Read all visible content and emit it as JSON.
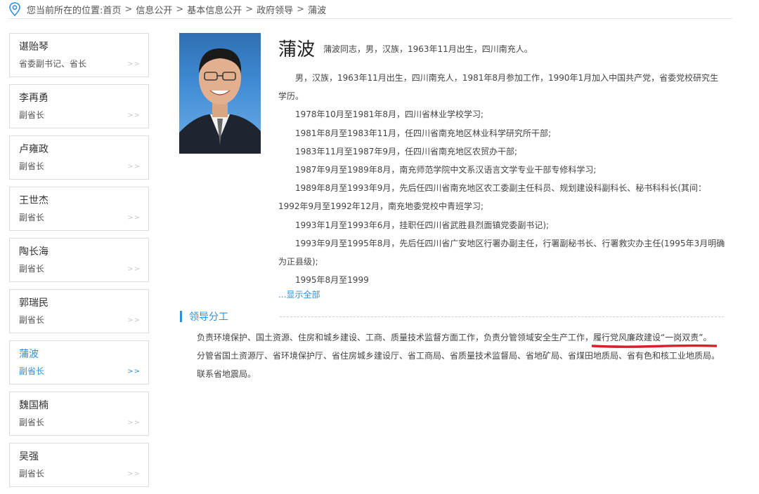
{
  "breadcrumb": {
    "prefix": "您当前所在的位置:",
    "items": [
      "首页",
      "信息公开",
      "基本信息公开",
      "政府领导",
      "蒲波"
    ],
    "separator": ">"
  },
  "sidebar": {
    "arrow": ">>",
    "items": [
      {
        "name": "谌贻琴",
        "title": "省委副书记、省长"
      },
      {
        "name": "李再勇",
        "title": "副省长"
      },
      {
        "name": "卢雍政",
        "title": "副省长"
      },
      {
        "name": "王世杰",
        "title": "副省长"
      },
      {
        "name": "陶长海",
        "title": "副省长"
      },
      {
        "name": "郭瑞民",
        "title": "副省长"
      },
      {
        "name": "蒲波",
        "title": "副省长"
      },
      {
        "name": "魏国楠",
        "title": "副省长"
      },
      {
        "name": "吴强",
        "title": "副省长"
      }
    ],
    "active_index": 6
  },
  "profile": {
    "name": "蒲波",
    "intro": "蒲波同志，男，汉族，1963年11月出生，四川南充人。",
    "bio": [
      "男，汉族，1963年11月出生，四川南充人，1981年8月参加工作，1990年1月加入中国共产党，省委党校研究生学历。",
      "1978年10月至1981年8月，四川省林业学校学习;",
      "1981年8月至1983年11月，任四川省南充地区林业科学研究所干部;",
      "1983年11月至1987年9月，任四川省南充地区农贸办干部;",
      "1987年9月至1989年8月，南充师范学院中文系汉语言文学专业干部专修科学习;",
      "1989年8月至1993年9月，先后任四川省南充地区农工委副主任科员、规划建设科副科长、秘书科科长(其间：1992年9月至1992年12月，南充地委党校中青班学习;",
      "1993年1月至1993年6月，挂职任四川省武胜县烈面镇党委副书记);",
      "1993年9月至1995年8月，先后任四川省广安地区行署办副主任，行署副秘书长、行署救灾办主任(1995年3月明确为正县级);",
      "1995年8月至1999"
    ],
    "show_all": "...显示全部"
  },
  "duties": {
    "title": "领导分工",
    "line1_a": "负责环境保护、国土资源、住房和城乡建设、工商、质量技术监督方面工作，负责分管领域安全生产工作，",
    "line1_b": "履行党风廉政建设“一岗双责”。",
    "line2": "分管省国土资源厅、省环境保护厅、省住房城乡建设厅、省工商局、省质量技术监督局、省地矿局、省煤田地质局、省有色和核工业地质局。",
    "line3": "联系省地震局。"
  },
  "colors": {
    "accent": "#2f8fd8",
    "annotation": "#d6202a"
  }
}
